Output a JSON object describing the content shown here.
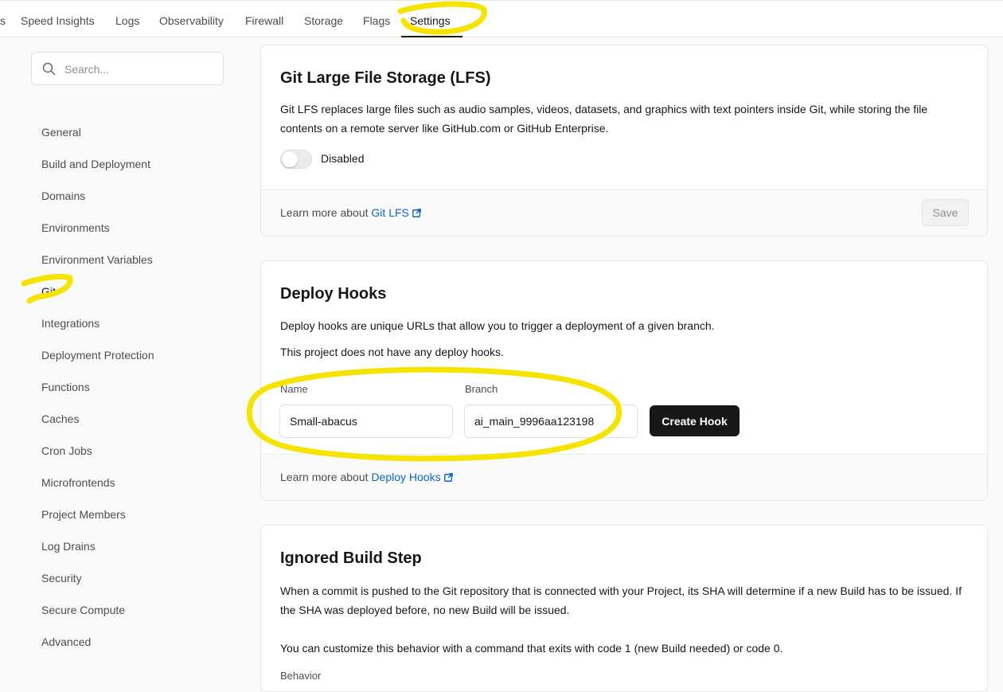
{
  "topnav": {
    "partial_tab": "s",
    "tabs": [
      "Speed Insights",
      "Logs",
      "Observability",
      "Firewall",
      "Storage",
      "Flags",
      "Settings"
    ],
    "active_tab": "Settings"
  },
  "sidebar": {
    "search_placeholder": "Search...",
    "items": [
      "General",
      "Build and Deployment",
      "Domains",
      "Environments",
      "Environment Variables",
      "Git",
      "Integrations",
      "Deployment Protection",
      "Functions",
      "Caches",
      "Cron Jobs",
      "Microfrontends",
      "Project Members",
      "Log Drains",
      "Security",
      "Secure Compute",
      "Advanced"
    ],
    "active_item": "Git"
  },
  "lfs": {
    "title": "Git Large File Storage (LFS)",
    "description": "Git LFS replaces large files such as audio samples, videos, datasets, and graphics with text pointers inside Git, while storing the file contents on a remote server like GitHub.com or GitHub Enterprise.",
    "toggle_label": "Disabled",
    "learn_prefix": "Learn more about",
    "learn_link": "Git LFS",
    "save_label": "Save"
  },
  "hooks": {
    "title": "Deploy Hooks",
    "description": "Deploy hooks are unique URLs that allow you to trigger a deployment of a given branch.",
    "empty_text": "This project does not have any deploy hooks.",
    "name_label": "Name",
    "name_value": "Small-abacus",
    "branch_label": "Branch",
    "branch_value": "ai_main_9996aa123198",
    "create_label": "Create Hook",
    "learn_prefix": "Learn more about",
    "learn_link": "Deploy Hooks"
  },
  "ignored": {
    "title": "Ignored Build Step",
    "description": "When a commit is pushed to the Git repository that is connected with your Project, its SHA will determine if a new Build has to be issued. If the SHA was deployed before, no new Build will be issued.",
    "description2": "You can customize this behavior with a command that exits with code 1 (new Build needed) or code 0.",
    "behavior_label": "Behavior"
  },
  "annotation_color": "#f5e400"
}
